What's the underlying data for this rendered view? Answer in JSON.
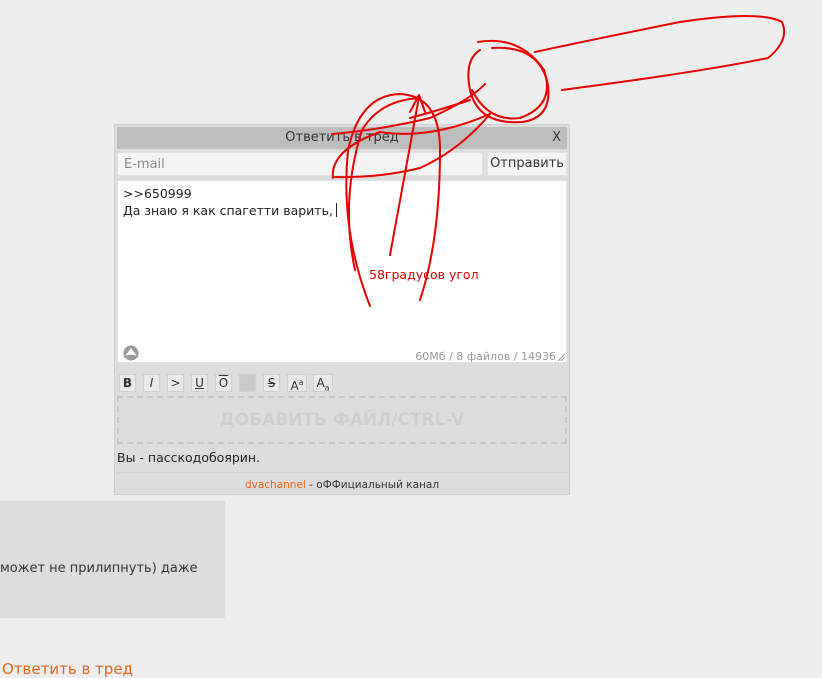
{
  "quick_reply": {
    "title": "Ответить в тред",
    "close_label": "X",
    "email_placeholder": "E-mail",
    "email_value": "",
    "send_label": "Отправить",
    "comment_lines": ">>650999\nДа знаю я как спагетти варить,",
    "limits": "60Мб / 8 файлов / 14936",
    "markup_buttons": [
      {
        "label": "B"
      },
      {
        "label": "I"
      },
      {
        "label": ">"
      },
      {
        "label": "U"
      },
      {
        "label": "O"
      },
      {
        "label": ""
      },
      {
        "label": "S"
      },
      {
        "label": "A",
        "sup": "a"
      },
      {
        "label": "A",
        "sub": "a"
      }
    ],
    "dropzone_label": "ДОБАВИТЬ ФАЙЛ/CTRL-V",
    "passcode_text": "Вы - пасскодобоярин.",
    "footer_link": "dvachannel",
    "footer_text": " - оФФициальный канал"
  },
  "post": {
    "text": "может не прилипнуть) даже"
  },
  "reply_link": "Ответить в тред",
  "annotation": {
    "text": "58градусов угол",
    "color": "#e00000"
  },
  "colors": {
    "accent": "#e6651b",
    "panel": "#dddddd",
    "header": "#bdbdbd"
  }
}
